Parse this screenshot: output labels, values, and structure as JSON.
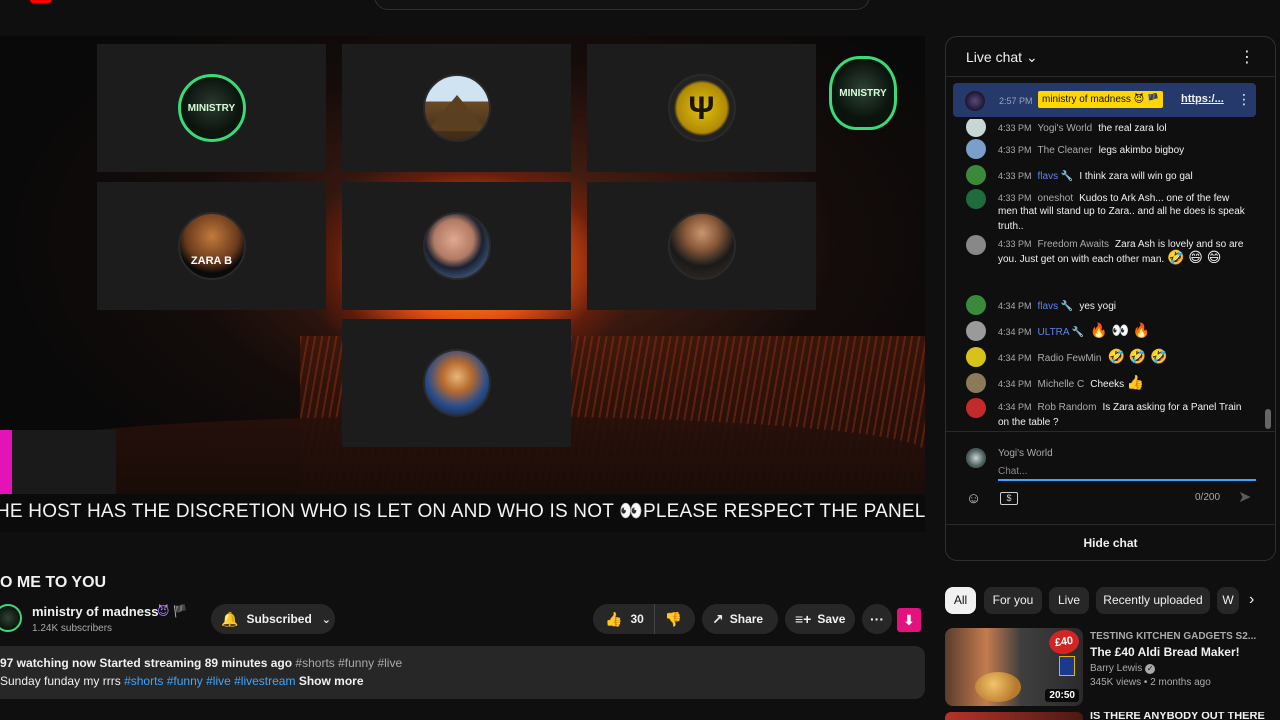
{
  "player": {
    "ticker_text": "HE HOST HAS THE DISCRETION WHO IS LET ON AND WHO IS NOT 👀PLEASE RESPECT THE PANEL AI",
    "corner_logo_text": "MINISTRY",
    "tiles": [
      {
        "id": "ministry",
        "label": "MINISTRY"
      },
      {
        "id": "tent",
        "label": ""
      },
      {
        "id": "logo",
        "label": "Ψ"
      },
      {
        "id": "zara",
        "label": "ZARA B"
      },
      {
        "id": "man1",
        "label": ""
      },
      {
        "id": "man2",
        "label": ""
      },
      {
        "id": "chucky",
        "label": ""
      }
    ]
  },
  "video": {
    "title": "O ME TO YOU",
    "channel_name": "ministry of madness",
    "channel_badges": "😈 🏴",
    "subscribers": "1.24K subscribers",
    "subscribe_label": "Subscribed",
    "likes": "30",
    "share_label": "Share",
    "save_label": "Save",
    "more_label": "···",
    "description": {
      "stats": "97 watching now  Started streaming 89 minutes ago",
      "stats_tags": "#shorts #funny #live",
      "line2_text": "Sunday funday my rrrs ",
      "line2_tags": "#shorts #funny #live #livestream",
      "show_more": "Show more"
    }
  },
  "chat": {
    "title": "Live chat",
    "pinned": {
      "time": "2:57 PM",
      "author": "ministry of madness 😈 🏴",
      "link": "https:/..."
    },
    "messages": [
      {
        "time": "4:33 PM",
        "author": "Yogi's World",
        "text": "the real zara lol",
        "emo": "",
        "mod": false,
        "color": "#c8d6d4"
      },
      {
        "time": "4:33 PM",
        "author": "The Cleaner",
        "text": "legs akimbo bigboy",
        "emo": "",
        "mod": false,
        "color": "#7a9fc8"
      },
      {
        "time": "4:33 PM",
        "author": "flavs 🔧",
        "text": "I think zara will win go gal",
        "emo": "",
        "mod": true,
        "color": "#3a8a3a"
      },
      {
        "time": "4:33 PM",
        "author": "oneshot",
        "text": "Kudos to Ark Ash... one of the few men that will stand up to Zara.. and all he does is speak truth..",
        "emo": "",
        "mod": false,
        "color": "#1f6b3b"
      },
      {
        "time": "4:33 PM",
        "author": "Freedom Awaits",
        "text": "Zara Ash is lovely and so are you. Just get on with each other man. ",
        "emo": "🤣 😄 😄",
        "mod": false,
        "color": "#888888"
      },
      {
        "time": "4:34 PM",
        "author": "flavs 🔧",
        "text": "yes yogi",
        "emo": "",
        "mod": true,
        "color": "#3a8a3a"
      },
      {
        "time": "4:34 PM",
        "author": "ULTRA 🔧",
        "text": "",
        "emo": "🔥 👀 🔥",
        "mod": true,
        "color": "#9a9a9a"
      },
      {
        "time": "4:34 PM",
        "author": "Radio FewMin",
        "text": "",
        "emo": "🤣 🤣 🤣",
        "mod": false,
        "color": "#d8c21a"
      },
      {
        "time": "4:34 PM",
        "author": "Michelle C",
        "text": "Cheeks ",
        "emo": "👍",
        "mod": false,
        "color": "#8a7a5a"
      },
      {
        "time": "4:34 PM",
        "author": "Rob Random",
        "text": "Is Zara asking for a Panel Train on the table ?",
        "emo": "",
        "mod": false,
        "color": "#c42a2a"
      }
    ],
    "composer": {
      "user": "Yogi's World",
      "placeholder": "Chat...",
      "count": "0/200"
    },
    "hide_label": "Hide chat"
  },
  "chips": [
    {
      "label": "All",
      "active": true
    },
    {
      "label": "For you",
      "active": false
    },
    {
      "label": "Live",
      "active": false
    },
    {
      "label": "Recently uploaded",
      "active": false
    },
    {
      "label": "W",
      "active": false
    }
  ],
  "recommendation": {
    "kicker": "TESTING KITCHEN GADGETS  S2...",
    "title": "The £40 Aldi Bread Maker!",
    "author": "Barry Lewis",
    "stats": "345K views • 2 months ago",
    "duration": "20:50",
    "badge": "£40",
    "next_title": "IS THERE ANYBODY OUT THERE"
  }
}
